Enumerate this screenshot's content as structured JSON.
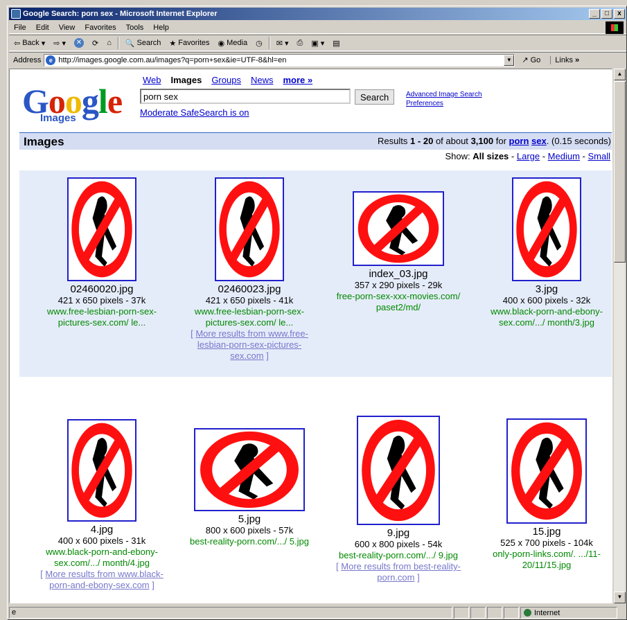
{
  "window": {
    "title": "Google Search: porn sex - Microsoft Internet Explorer",
    "controls": [
      "_",
      "□",
      "x"
    ]
  },
  "menu": [
    "File",
    "Edit",
    "View",
    "Favorites",
    "Tools",
    "Help"
  ],
  "toolbar": {
    "back": "Back",
    "search": "Search",
    "favorites": "Favorites",
    "media": "Media"
  },
  "address": {
    "label": "Address",
    "url": "http://images.google.com.au/images?q=porn+sex&ie=UTF-8&hl=en",
    "go": "Go",
    "links": "Links"
  },
  "page": {
    "logo_text": "Google",
    "logo_sub": "Images",
    "nav": {
      "web": "Web",
      "images": "Images",
      "groups": "Groups",
      "news": "News",
      "more": "more »"
    },
    "query": "porn sex",
    "search_button": "Search",
    "advanced_link": "Advanced Image Search",
    "prefs_link": "Preferences",
    "safesearch": "Moderate SafeSearch is on",
    "section_title": "Images",
    "results_prefix": "Results",
    "results_range_start": "1",
    "results_dash": "-",
    "results_range_end": "20",
    "results_of_about": "of about",
    "results_total": "3,100",
    "results_for": "for",
    "results_term1": "porn",
    "results_term2": "sex",
    "results_time": "(0.15 seconds)",
    "show_label": "Show:",
    "show_all": "All sizes",
    "show_large": "Large",
    "show_medium": "Medium",
    "show_small": "Small"
  },
  "results": [
    {
      "file": "02460020.jpg",
      "info": "421 x 650 pixels - 37k",
      "url1": "www.free-lesbian-porn-sex-",
      "url2": "pictures-sex.com/ le...",
      "more": ""
    },
    {
      "file": "02460023.jpg",
      "info": "421 x 650 pixels - 41k",
      "url1": "www.free-lesbian-porn-sex-",
      "url2": "pictures-sex.com/ le...",
      "more": "More results from www.free-lesbian-porn-sex-pictures-sex.com"
    },
    {
      "file": "index_03.jpg",
      "info": "357 x 290 pixels - 29k",
      "url1": "free-porn-sex-xxx-movies.com/",
      "url2": "paset2/md/",
      "more": ""
    },
    {
      "file": "3.jpg",
      "info": "400 x 600 pixels - 32k",
      "url1": "www.black-porn-and-ebony-",
      "url2": "sex.com/.../ month/3.jpg",
      "more": ""
    },
    {
      "file": "4.jpg",
      "info": "400 x 600 pixels - 31k",
      "url1": "www.black-porn-and-ebony-",
      "url2": "sex.com/.../ month/4.jpg",
      "more": "More results from www.black-porn-and-ebony-sex.com"
    },
    {
      "file": "5.jpg",
      "info": "800 x 600 pixels - 57k",
      "url1": "best-reality-porn.com/.../ 5.jpg",
      "url2": "",
      "more": ""
    },
    {
      "file": "9.jpg",
      "info": "600 x 800 pixels - 54k",
      "url1": "best-reality-porn.com/.../ 9.jpg",
      "url2": "",
      "more": "More results from best-reality-porn.com"
    },
    {
      "file": "15.jpg",
      "info": "525 x 700 pixels - 104k",
      "url1": "only-porn-links.com/. .../11-",
      "url2": "20/11/15.jpg",
      "more": ""
    }
  ],
  "status": {
    "zone": "Internet"
  },
  "colors": {
    "accent": "#3366cc",
    "result_url": "#008000",
    "link": "#0000cc",
    "sign_red": "#ff1010"
  }
}
